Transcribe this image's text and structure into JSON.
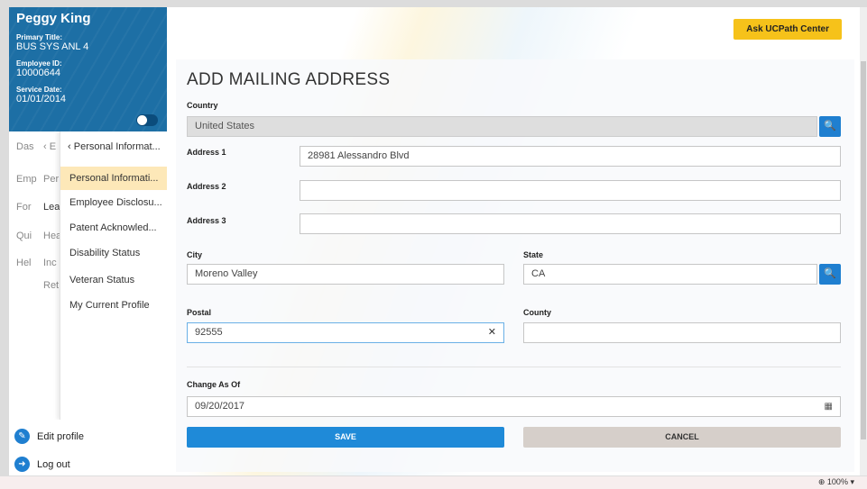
{
  "profile": {
    "name": "Peggy King",
    "primary_title_label": "Primary Title:",
    "primary_title": "BUS SYS ANL 4",
    "employee_id_label": "Employee ID:",
    "employee_id": "10000644",
    "service_date_label": "Service Date:",
    "service_date": "01/01/2014"
  },
  "nav": {
    "col1": [
      "Das",
      "Emp",
      "For",
      "Qui",
      "Hel"
    ],
    "col2": [
      "‹ E",
      "Per",
      "Lea",
      "Hea",
      "Inc",
      "Ret"
    ],
    "col3_header": "Personal Informat...",
    "col3_items": [
      "Personal Informati...",
      "Employee Disclosu...",
      "Patent Acknowled...",
      "Disability Status",
      "Veteran Status",
      "My Current Profile"
    ],
    "col1_back": "‹"
  },
  "actions": {
    "edit_profile": "Edit profile",
    "log_out": "Log out"
  },
  "header": {
    "ask_button": "Ask UCPath Center"
  },
  "form": {
    "title": "ADD MAILING ADDRESS",
    "country_label": "Country",
    "country_value": "United States",
    "address1_label": "Address 1",
    "address1_value": "28981 Alessandro Blvd",
    "address2_label": "Address 2",
    "address2_value": "",
    "address3_label": "Address 3",
    "address3_value": "",
    "city_label": "City",
    "city_value": "Moreno Valley",
    "state_label": "State",
    "state_value": "CA",
    "postal_label": "Postal",
    "postal_value": "92555",
    "county_label": "County",
    "county_value": "",
    "change_as_of_label": "Change As Of",
    "change_as_of_value": "09/20/2017",
    "save_label": "SAVE",
    "cancel_label": "CANCEL"
  },
  "statusbar": {
    "zoom": "100%"
  },
  "colors": {
    "brand_blue": "#1d6fa5",
    "accent_blue": "#1f7fd0",
    "ask_yellow": "#f6c21a",
    "active_item": "#fde8b8"
  }
}
